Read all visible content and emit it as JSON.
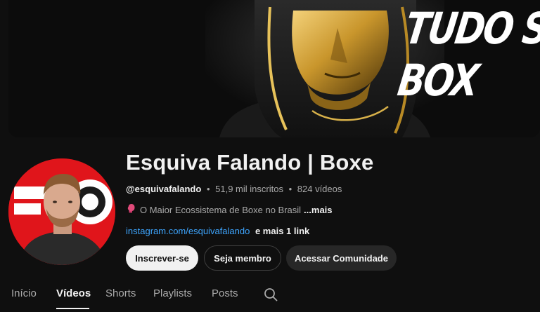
{
  "banner": {
    "headline": "TUDO S\nBOX"
  },
  "channel": {
    "name": "Esquiva Falando | Boxe",
    "handle": "@esquivafalando",
    "subscribers": "51,9 mil inscritos",
    "videos": "824 vídeos",
    "separator": "•",
    "description": "O Maior Ecossistema de Boxe no Brasil",
    "more_label": "...mais",
    "link_text": "instagram.com/esquivafalando",
    "more_links": "e mais 1 link"
  },
  "buttons": {
    "subscribe": "Inscrever-se",
    "member": "Seja membro",
    "community": "Acessar Comunidade"
  },
  "tabs": [
    {
      "label": "Início"
    },
    {
      "label": "Vídeos"
    },
    {
      "label": "Shorts"
    },
    {
      "label": "Playlists"
    },
    {
      "label": "Posts"
    }
  ],
  "active_tab": "Vídeos",
  "icons": {
    "description": "boxing-glove-icon",
    "search": "search-icon"
  },
  "colors": {
    "background": "#0f0f0f",
    "link": "#3ea6ff",
    "avatar_bg": "#e0151b",
    "banner_gold": "#c9a23a"
  }
}
